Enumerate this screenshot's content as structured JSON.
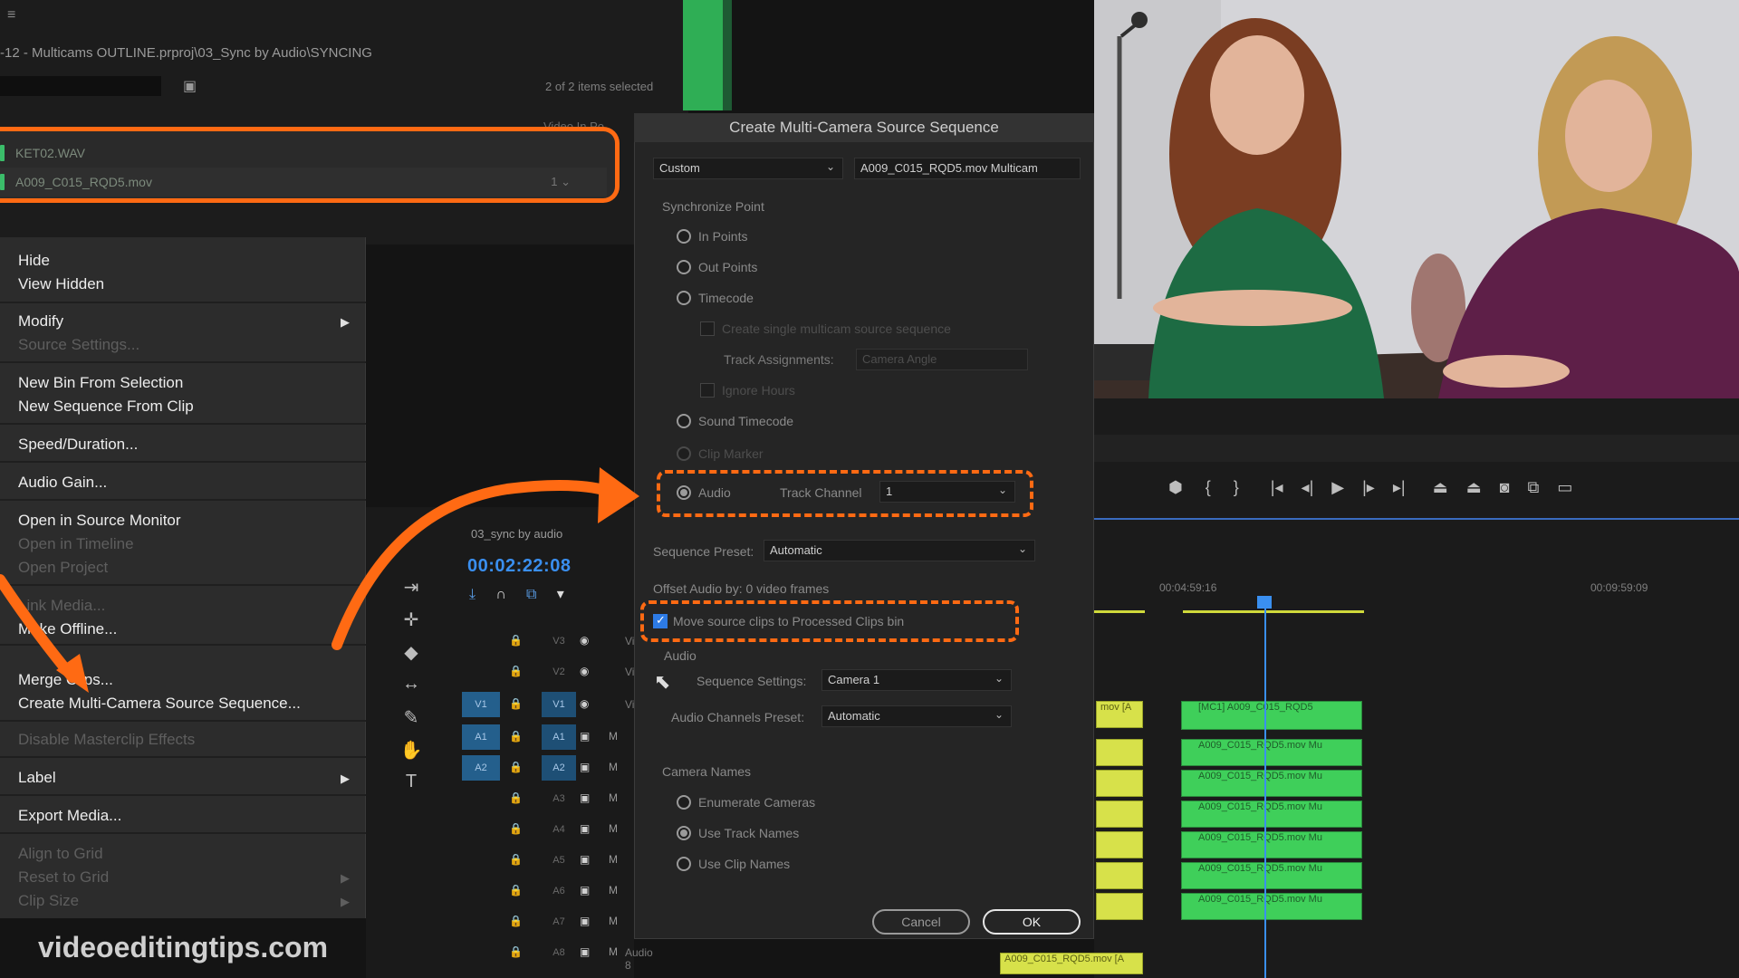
{
  "project_panel": {
    "path": "-12 - Multicams OUTLINE.prproj\\03_Sync by Audio\\SYNCING",
    "items_selected": "2 of 2 items selected",
    "list_header": "Video In Po",
    "files": [
      {
        "name": "KET02.WAV",
        "extra": ""
      },
      {
        "name": "A009_C015_RQD5.mov",
        "extra": "1 ⌄"
      }
    ]
  },
  "context_menu": {
    "groups": [
      {
        "items": [
          {
            "label": "Hide",
            "enabled": true
          },
          {
            "label": "View Hidden",
            "enabled": true
          }
        ]
      },
      {
        "items": [
          {
            "label": "Modify",
            "enabled": true,
            "submenu": true
          },
          {
            "label": "Source Settings...",
            "enabled": false
          }
        ]
      },
      {
        "items": [
          {
            "label": "New Bin From Selection",
            "enabled": true
          },
          {
            "label": "New Sequence From Clip",
            "enabled": true
          }
        ]
      },
      {
        "items": [
          {
            "label": "Speed/Duration...",
            "enabled": true
          }
        ]
      },
      {
        "items": [
          {
            "label": "Audio Gain...",
            "enabled": true
          }
        ]
      },
      {
        "items": [
          {
            "label": "Open in Source Monitor",
            "enabled": true
          },
          {
            "label": "Open in Timeline",
            "enabled": false
          },
          {
            "label": "Open Project",
            "enabled": false
          }
        ]
      },
      {
        "items": [
          {
            "label": "Link Media...",
            "enabled": false
          },
          {
            "label": "Make Offline...",
            "enabled": true
          }
        ]
      },
      {
        "items": [
          {
            "label": "Merge Clips...",
            "enabled": true
          },
          {
            "label": "Create Multi-Camera Source Sequence...",
            "enabled": true
          }
        ]
      },
      {
        "items": [
          {
            "label": "Disable Masterclip Effects",
            "enabled": false
          }
        ]
      },
      {
        "items": [
          {
            "label": "Label",
            "enabled": true,
            "submenu": true
          }
        ]
      },
      {
        "items": [
          {
            "label": "Export Media...",
            "enabled": true
          }
        ]
      },
      {
        "items": [
          {
            "label": "Align to Grid",
            "enabled": false
          },
          {
            "label": "Reset to Grid",
            "enabled": false,
            "submenu": true
          },
          {
            "label": "Clip Size",
            "enabled": false,
            "submenu": true
          }
        ]
      }
    ]
  },
  "timeline": {
    "sequence_tab": "03_sync by audio",
    "timecode": "00:02:22:08",
    "ruler_1": "00:04:59:16",
    "ruler_2": "00:09:59:09",
    "tracks": [
      {
        "src": "",
        "tgt": "V3",
        "name": "Video"
      },
      {
        "src": "",
        "tgt": "V2",
        "name": "Video"
      },
      {
        "src": "V1",
        "tgt": "V1",
        "name": "Video"
      },
      {
        "src": "A1",
        "tgt": "A1",
        "name": ""
      },
      {
        "src": "A2",
        "tgt": "A2",
        "name": ""
      },
      {
        "src": "",
        "tgt": "A3",
        "name": ""
      },
      {
        "src": "",
        "tgt": "A4",
        "name": ""
      },
      {
        "src": "",
        "tgt": "A5",
        "name": ""
      },
      {
        "src": "",
        "tgt": "A6",
        "name": ""
      },
      {
        "src": "",
        "tgt": "A7",
        "name": ""
      },
      {
        "src": "",
        "tgt": "A8",
        "name": "Audio 8"
      }
    ],
    "clips": {
      "top_clip": "[MC1] A009_C015_RQD5",
      "audio_clip": "A009_C015_RQD5.mov Mu",
      "left_clip": "mov [A",
      "bottom_clip": "A009_C015_RQD5.mov [A"
    }
  },
  "dialog": {
    "title": "Create Multi-Camera Source Sequence",
    "name_preset": "Custom",
    "name_value": "A009_C015_RQD5.mov Multicam",
    "sync_point_label": "Synchronize Point",
    "in_points": "In Points",
    "out_points": "Out Points",
    "timecode": "Timecode",
    "create_single": "Create single multicam source sequence",
    "track_assignments": "Track Assignments:",
    "track_assignments_value": "Camera Angle",
    "ignore_hours": "Ignore Hours",
    "sound_timecode": "Sound Timecode",
    "clip_marker": "Clip Marker",
    "audio": "Audio",
    "track_channel": "Track Channel",
    "track_channel_value": "1",
    "sequence_preset_label": "Sequence Preset:",
    "sequence_preset_value": "Automatic",
    "offset_audio": "Offset Audio by:  0  video frames",
    "move_source": "Move source clips to Processed Clips bin",
    "audio_section": "Audio",
    "sequence_settings_label": "Sequence Settings:",
    "sequence_settings_value": "Camera 1",
    "audio_channels_label": "Audio Channels Preset:",
    "audio_channels_value": "Automatic",
    "camera_names_label": "Camera Names",
    "enumerate_cameras": "Enumerate Cameras",
    "use_track_names": "Use Track Names",
    "use_clip_names": "Use Clip Names",
    "cancel": "Cancel",
    "ok": "OK"
  },
  "watermark": "videoeditingtips.com",
  "colors": {
    "highlight": "#ff6a13",
    "timecode_blue": "#3a8ff0",
    "clip_green": "#3fcf5a"
  }
}
